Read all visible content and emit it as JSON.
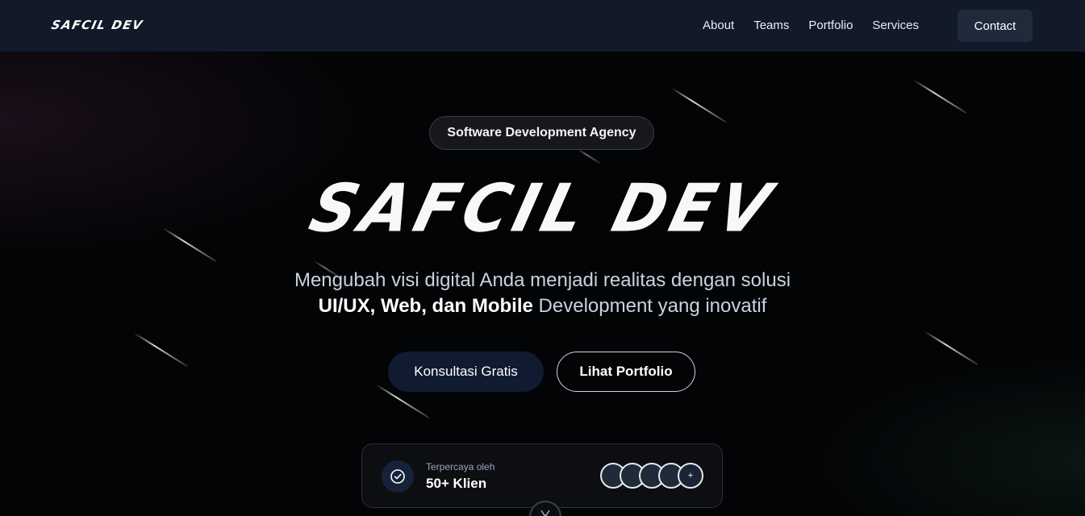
{
  "nav": {
    "logo": "SAFCIL DEV",
    "links": [
      "About",
      "Teams",
      "Portfolio",
      "Services"
    ],
    "contact_label": "Contact"
  },
  "hero": {
    "badge": "Software Development Agency",
    "title": "SAFCIL DEV",
    "subtitle_line1": "Mengubah visi digital Anda menjadi realitas dengan solusi",
    "subtitle_bold": "UI/UX, Web, dan Mobile",
    "subtitle_rest": " Development yang inovatif",
    "primary_cta": "Konsultasi Gratis",
    "secondary_cta": "Lihat Portfolio"
  },
  "trust": {
    "label": "Terpercaya oleh",
    "value": "50+ Klien",
    "more_label": "+",
    "icon": "check-circle-icon"
  },
  "colors": {
    "nav_bg": "#121a2a",
    "page_bg": "#030406",
    "primary_btn": "#101a30",
    "contact_btn": "#1f2a3a"
  }
}
